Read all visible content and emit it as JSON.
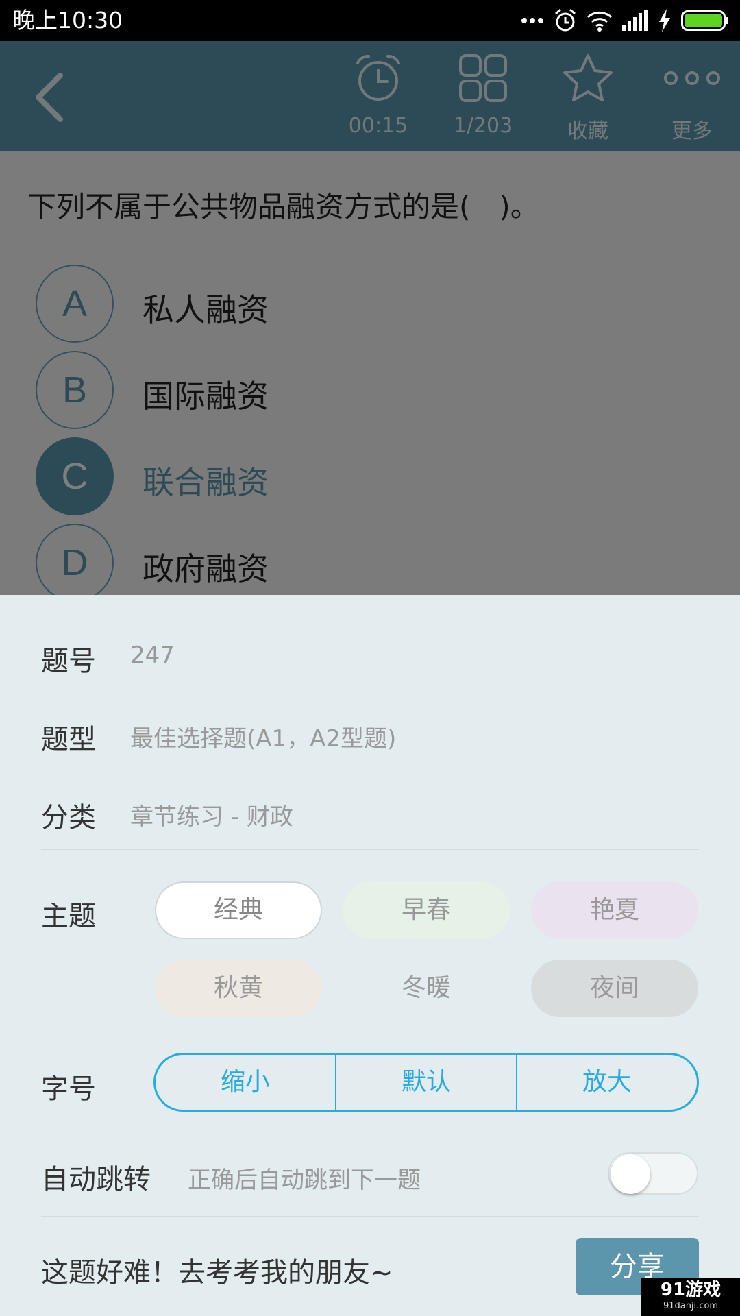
{
  "status_bar": {
    "time": "晚上10:30",
    "battery_color": "#5fd321"
  },
  "toolbar": {
    "back_icon": "chevron-left-icon",
    "timer": {
      "icon": "alarm-clock-icon",
      "label": "00:15"
    },
    "progress": {
      "icon": "grid-icon",
      "label": "1/203"
    },
    "favorite": {
      "icon": "star-icon",
      "label": "收藏"
    },
    "more": {
      "icon": "more-dots-icon",
      "label": "更多"
    }
  },
  "question": {
    "text": "下列不属于公共物品融资方式的是(　)。",
    "options": [
      {
        "letter": "A",
        "text": "私人融资",
        "selected": false
      },
      {
        "letter": "B",
        "text": "国际融资",
        "selected": false
      },
      {
        "letter": "C",
        "text": "联合融资",
        "selected": true
      },
      {
        "letter": "D",
        "text": "政府融资",
        "selected": false
      }
    ]
  },
  "sheet": {
    "question_no": {
      "label": "题号",
      "value": "247"
    },
    "question_type": {
      "label": "题型",
      "value": "最佳选择题(A1，A2型题)"
    },
    "category": {
      "label": "分类",
      "value": "章节练习 - 财政"
    },
    "theme": {
      "label": "主题",
      "options": [
        "经典",
        "早春",
        "艳夏",
        "秋黄",
        "冬暖",
        "夜间"
      ],
      "selected": "经典"
    },
    "font_size": {
      "label": "字号",
      "options": [
        "缩小",
        "默认",
        "放大"
      ]
    },
    "auto_jump": {
      "label": "自动跳转",
      "description": "正确后自动跳到下一题",
      "enabled": false
    },
    "share": {
      "text": "这题好难！去考考我的朋友~",
      "button": "分享"
    }
  },
  "watermark": {
    "logo": "91游戏",
    "url": "91danji.com"
  },
  "colors": {
    "primary": "#5b96ad",
    "accent_blue": "#29abe2",
    "sheet_bg": "#e3ecef"
  }
}
